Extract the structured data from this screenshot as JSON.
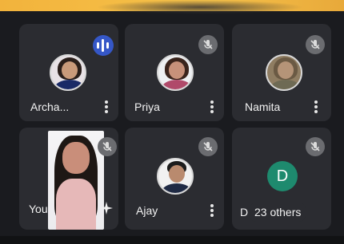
{
  "participants": [
    {
      "name": "Archa...",
      "speaking": true,
      "muted": false
    },
    {
      "name": "Priya",
      "muted": true
    },
    {
      "name": "Namita",
      "muted": true
    },
    {
      "name": "You",
      "muted": true
    },
    {
      "name": "Ajay",
      "muted": true
    },
    {
      "initial": "D",
      "partial_name": "D",
      "others_label": "23 others",
      "muted": true
    }
  ],
  "icons": {
    "more": "more-vert-icon",
    "mute": "mic-off-icon",
    "speaking": "audio-wave-icon",
    "effects": "sparkle-icon"
  },
  "colors": {
    "tile": "#2b2c31",
    "speaking": "#3557c7",
    "avatar_d": "#1e8a6e"
  }
}
